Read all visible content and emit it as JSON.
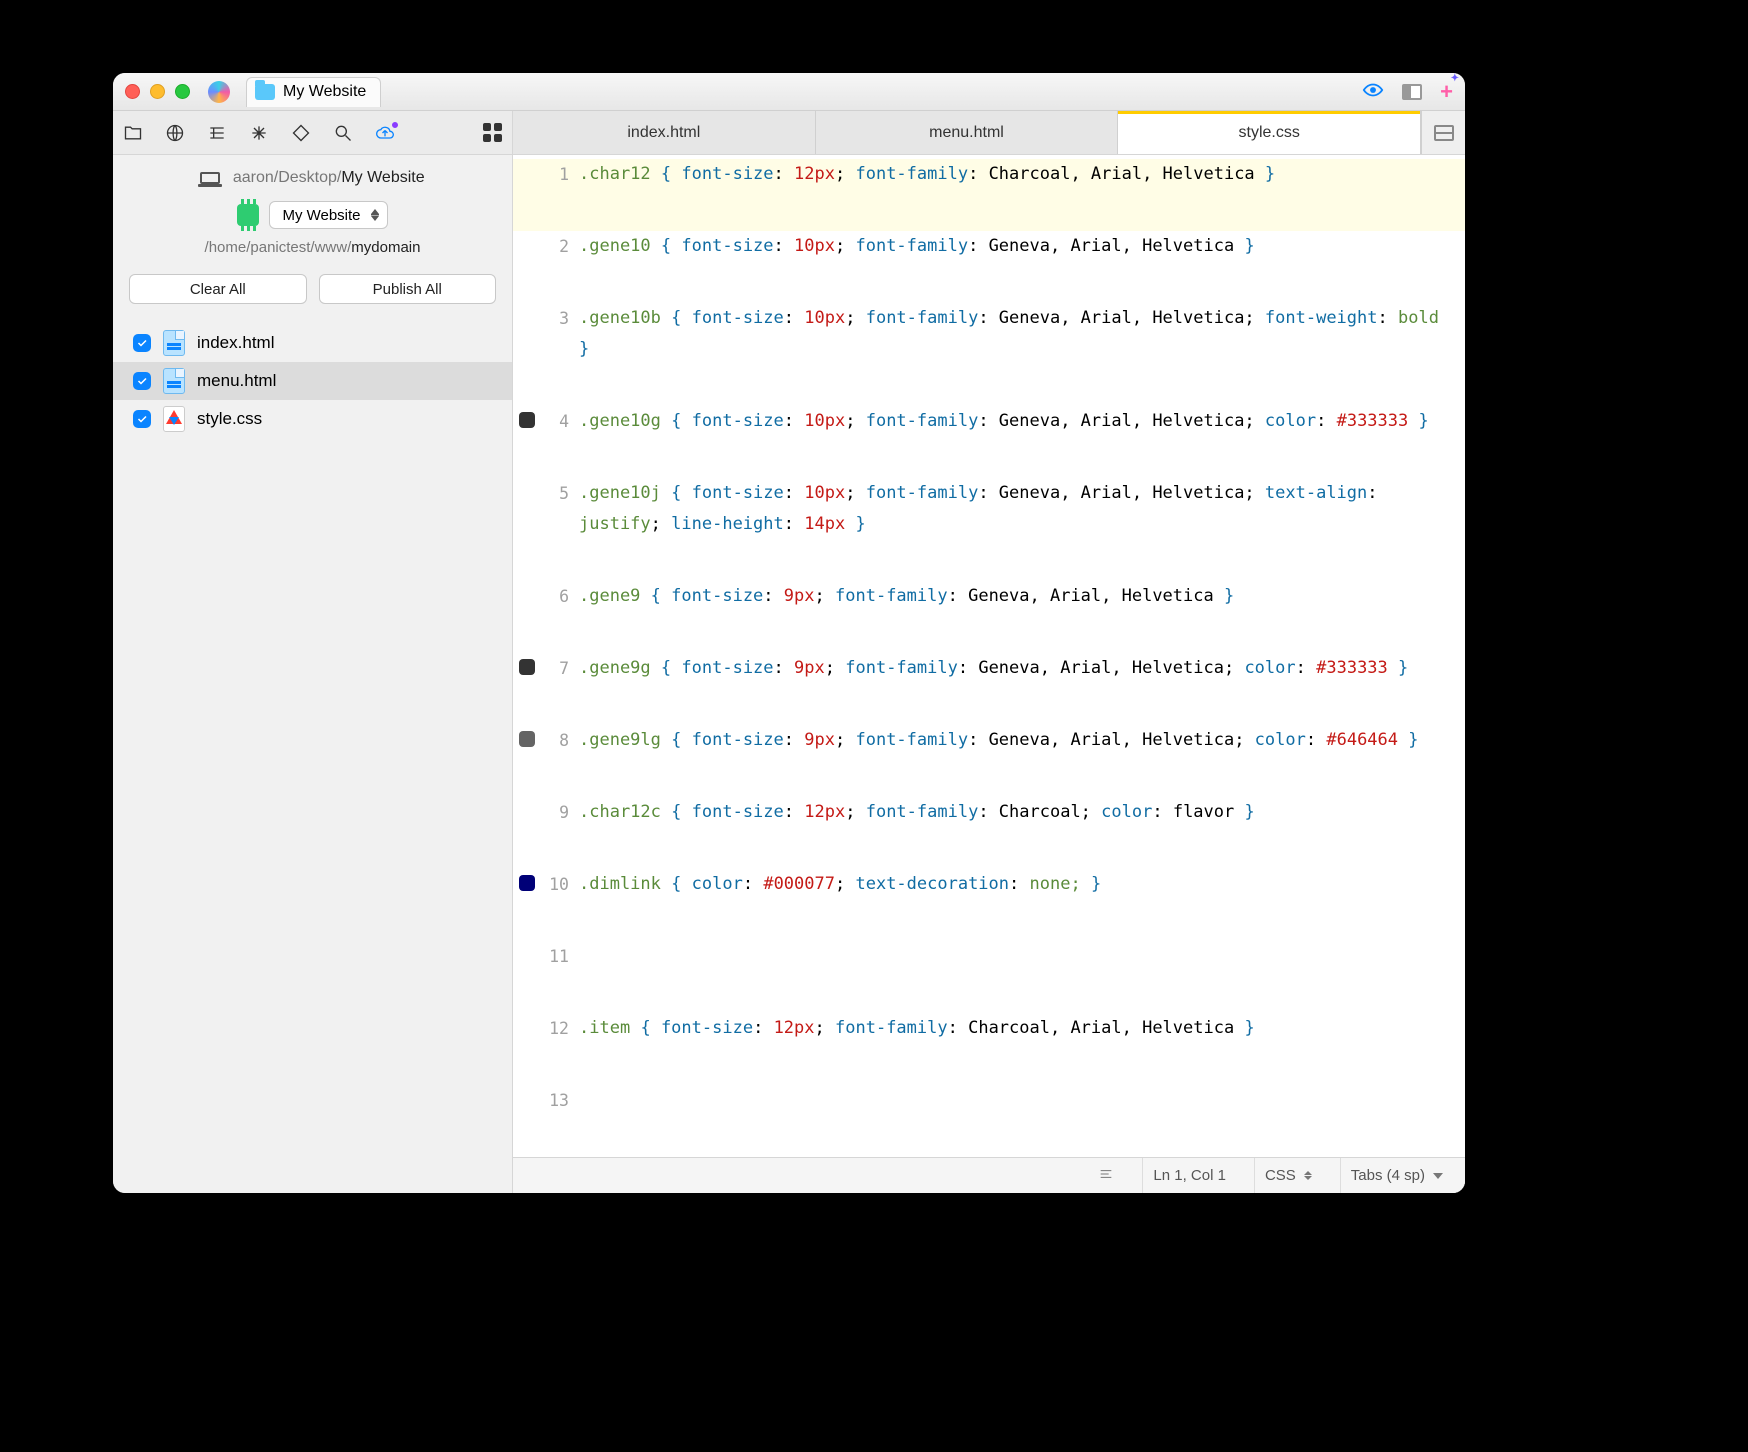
{
  "window": {
    "title": "My Website"
  },
  "breadcrumb": {
    "prefix": "aaron/Desktop/",
    "current": "My Website"
  },
  "project": {
    "selected": "My Website"
  },
  "remote_path": {
    "prefix": "/home/panictest/www/",
    "current": "mydomain"
  },
  "buttons": {
    "clear": "Clear All",
    "publish": "Publish All"
  },
  "files": [
    {
      "name": "index.html",
      "icon": "html",
      "checked": true,
      "selected": false
    },
    {
      "name": "menu.html",
      "icon": "html",
      "checked": true,
      "selected": true
    },
    {
      "name": "style.css",
      "icon": "css",
      "checked": true,
      "selected": false
    }
  ],
  "tabs": [
    {
      "label": "index.html",
      "active": false
    },
    {
      "label": "menu.html",
      "active": false
    },
    {
      "label": "style.css",
      "active": true
    }
  ],
  "code_lines": [
    {
      "n": 1,
      "swatch": null,
      "hl": true,
      "tokens": [
        [
          ".char12",
          "sel"
        ],
        [
          " ",
          "p"
        ],
        [
          "{",
          "brace"
        ],
        [
          " ",
          "p"
        ],
        [
          "font-size",
          "prop"
        ],
        [
          ":",
          "p"
        ],
        [
          " ",
          "p"
        ],
        [
          "12px",
          "num"
        ],
        [
          ";",
          "p"
        ],
        [
          " ",
          "p"
        ],
        [
          "font-family",
          "prop"
        ],
        [
          ":",
          "p"
        ],
        [
          " Charcoal, Arial, Helvetica ",
          "val"
        ],
        [
          "}",
          "brace"
        ]
      ]
    },
    {
      "n": 2,
      "swatch": null,
      "hl": false,
      "tokens": [
        [
          ".gene10",
          "sel"
        ],
        [
          " ",
          "p"
        ],
        [
          "{",
          "brace"
        ],
        [
          " ",
          "p"
        ],
        [
          "font-size",
          "prop"
        ],
        [
          ":",
          "p"
        ],
        [
          " ",
          "p"
        ],
        [
          "10px",
          "num"
        ],
        [
          ";",
          "p"
        ],
        [
          " ",
          "p"
        ],
        [
          "font-family",
          "prop"
        ],
        [
          ":",
          "p"
        ],
        [
          " Geneva, Arial, Helvetica ",
          "val"
        ],
        [
          "}",
          "brace"
        ]
      ]
    },
    {
      "n": 3,
      "swatch": null,
      "hl": false,
      "tokens": [
        [
          ".gene10b",
          "sel"
        ],
        [
          " ",
          "p"
        ],
        [
          "{",
          "brace"
        ],
        [
          " ",
          "p"
        ],
        [
          "font-size",
          "prop"
        ],
        [
          ":",
          "p"
        ],
        [
          " ",
          "p"
        ],
        [
          "10px",
          "num"
        ],
        [
          ";",
          "p"
        ],
        [
          " ",
          "p"
        ],
        [
          "font-family",
          "prop"
        ],
        [
          ":",
          "p"
        ],
        [
          " Geneva, Arial, Helvetica; ",
          "val"
        ],
        [
          "font-weight",
          "prop"
        ],
        [
          ":",
          "p"
        ],
        [
          " ",
          "p"
        ],
        [
          "bold",
          "kw"
        ],
        [
          " ",
          "p"
        ],
        [
          "}",
          "brace"
        ]
      ]
    },
    {
      "n": 4,
      "swatch": "#333333",
      "hl": false,
      "tokens": [
        [
          ".gene10g",
          "sel"
        ],
        [
          " ",
          "p"
        ],
        [
          "{",
          "brace"
        ],
        [
          " ",
          "p"
        ],
        [
          "font-size",
          "prop"
        ],
        [
          ":",
          "p"
        ],
        [
          " ",
          "p"
        ],
        [
          "10px",
          "num"
        ],
        [
          ";",
          "p"
        ],
        [
          " ",
          "p"
        ],
        [
          "font-family",
          "prop"
        ],
        [
          ":",
          "p"
        ],
        [
          " Geneva, Arial, Helvetica; ",
          "val"
        ],
        [
          "color",
          "prop"
        ],
        [
          ":",
          "p"
        ],
        [
          " ",
          "p"
        ],
        [
          "#333333",
          "num"
        ],
        [
          " ",
          "p"
        ],
        [
          "}",
          "brace"
        ]
      ]
    },
    {
      "n": 5,
      "swatch": null,
      "hl": false,
      "tokens": [
        [
          ".gene10j",
          "sel"
        ],
        [
          " ",
          "p"
        ],
        [
          "{",
          "brace"
        ],
        [
          " ",
          "p"
        ],
        [
          "font-size",
          "prop"
        ],
        [
          ":",
          "p"
        ],
        [
          " ",
          "p"
        ],
        [
          "10px",
          "num"
        ],
        [
          ";",
          "p"
        ],
        [
          " ",
          "p"
        ],
        [
          "font-family",
          "prop"
        ],
        [
          ":",
          "p"
        ],
        [
          " Geneva, Arial, Helvetica; ",
          "val"
        ],
        [
          "text-align",
          "prop"
        ],
        [
          ":",
          "p"
        ],
        [
          " ",
          "p"
        ],
        [
          "justify",
          "kw"
        ],
        [
          ";",
          "p"
        ],
        [
          " ",
          "p"
        ],
        [
          "line-height",
          "prop"
        ],
        [
          ":",
          "p"
        ],
        [
          " ",
          "p"
        ],
        [
          "14px",
          "num"
        ],
        [
          " ",
          "p"
        ],
        [
          "}",
          "brace"
        ]
      ]
    },
    {
      "n": 6,
      "swatch": null,
      "hl": false,
      "tokens": [
        [
          ".gene9",
          "sel"
        ],
        [
          " ",
          "p"
        ],
        [
          "{",
          "brace"
        ],
        [
          " ",
          "p"
        ],
        [
          "font-size",
          "prop"
        ],
        [
          ":",
          "p"
        ],
        [
          " ",
          "p"
        ],
        [
          "9px",
          "num"
        ],
        [
          ";",
          "p"
        ],
        [
          " ",
          "p"
        ],
        [
          "font-family",
          "prop"
        ],
        [
          ":",
          "p"
        ],
        [
          " Geneva, Arial, Helvetica ",
          "val"
        ],
        [
          "}",
          "brace"
        ]
      ]
    },
    {
      "n": 7,
      "swatch": "#333333",
      "hl": false,
      "tokens": [
        [
          ".gene9g",
          "sel"
        ],
        [
          " ",
          "p"
        ],
        [
          "{",
          "brace"
        ],
        [
          " ",
          "p"
        ],
        [
          "font-size",
          "prop"
        ],
        [
          ":",
          "p"
        ],
        [
          " ",
          "p"
        ],
        [
          "9px",
          "num"
        ],
        [
          ";",
          "p"
        ],
        [
          " ",
          "p"
        ],
        [
          "font-family",
          "prop"
        ],
        [
          ":",
          "p"
        ],
        [
          " Geneva, Arial, Helvetica; ",
          "val"
        ],
        [
          "color",
          "prop"
        ],
        [
          ":",
          "p"
        ],
        [
          " ",
          "p"
        ],
        [
          "#333333",
          "num"
        ],
        [
          " ",
          "p"
        ],
        [
          "}",
          "brace"
        ]
      ]
    },
    {
      "n": 8,
      "swatch": "#646464",
      "hl": false,
      "tokens": [
        [
          ".gene9lg",
          "sel"
        ],
        [
          " ",
          "p"
        ],
        [
          "{",
          "brace"
        ],
        [
          " ",
          "p"
        ],
        [
          "font-size",
          "prop"
        ],
        [
          ":",
          "p"
        ],
        [
          " ",
          "p"
        ],
        [
          "9px",
          "num"
        ],
        [
          ";",
          "p"
        ],
        [
          " ",
          "p"
        ],
        [
          "font-family",
          "prop"
        ],
        [
          ":",
          "p"
        ],
        [
          " Geneva, Arial, Helvetica; ",
          "val"
        ],
        [
          "color",
          "prop"
        ],
        [
          ":",
          "p"
        ],
        [
          " ",
          "p"
        ],
        [
          "#646464",
          "num"
        ],
        [
          " ",
          "p"
        ],
        [
          "}",
          "brace"
        ]
      ]
    },
    {
      "n": 9,
      "swatch": null,
      "hl": false,
      "tokens": [
        [
          ".char12c",
          "sel"
        ],
        [
          " ",
          "p"
        ],
        [
          "{",
          "brace"
        ],
        [
          " ",
          "p"
        ],
        [
          "font-size",
          "prop"
        ],
        [
          ":",
          "p"
        ],
        [
          " ",
          "p"
        ],
        [
          "12px",
          "num"
        ],
        [
          ";",
          "p"
        ],
        [
          " ",
          "p"
        ],
        [
          "font-family",
          "prop"
        ],
        [
          ":",
          "p"
        ],
        [
          " Charcoal; ",
          "val"
        ],
        [
          "color",
          "prop"
        ],
        [
          ":",
          "p"
        ],
        [
          " flavor ",
          "val"
        ],
        [
          "}",
          "brace"
        ]
      ]
    },
    {
      "n": 10,
      "swatch": "#000077",
      "hl": false,
      "tokens": [
        [
          ".dimlink",
          "sel"
        ],
        [
          " ",
          "p"
        ],
        [
          "{",
          "brace"
        ],
        [
          " ",
          "p"
        ],
        [
          "color",
          "prop"
        ],
        [
          ":",
          "p"
        ],
        [
          " ",
          "p"
        ],
        [
          "#000077",
          "num"
        ],
        [
          ";",
          "p"
        ],
        [
          " ",
          "p"
        ],
        [
          "text-decoration",
          "prop"
        ],
        [
          ":",
          "p"
        ],
        [
          " ",
          "p"
        ],
        [
          "none;",
          "kw"
        ],
        [
          " ",
          "p"
        ],
        [
          "}",
          "brace"
        ]
      ]
    },
    {
      "n": 11,
      "swatch": null,
      "hl": false,
      "tokens": []
    },
    {
      "n": 12,
      "swatch": null,
      "hl": false,
      "tokens": [
        [
          ".item",
          "sel"
        ],
        [
          " ",
          "p"
        ],
        [
          "{",
          "brace"
        ],
        [
          " ",
          "p"
        ],
        [
          "font-size",
          "prop"
        ],
        [
          ":",
          "p"
        ],
        [
          " ",
          "p"
        ],
        [
          "12px",
          "num"
        ],
        [
          ";",
          "p"
        ],
        [
          " ",
          "p"
        ],
        [
          "font-family",
          "prop"
        ],
        [
          ":",
          "p"
        ],
        [
          " Charcoal, Arial, Helvetica ",
          "val"
        ],
        [
          "}",
          "brace"
        ]
      ]
    },
    {
      "n": 13,
      "swatch": null,
      "hl": false,
      "tokens": []
    }
  ],
  "status": {
    "position": "Ln 1, Col 1",
    "lang": "CSS",
    "indent": "Tabs (4 sp)"
  }
}
